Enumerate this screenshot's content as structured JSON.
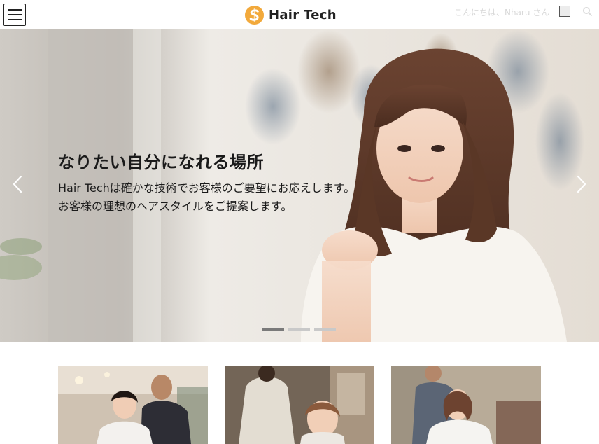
{
  "header": {
    "menu_icon": "hamburger-menu-icon",
    "logo_icon": "hair-tech-logo-mark",
    "brand": "Hair Tech",
    "greeting": "こんにちは、Nharu さん",
    "search_icon": "search-icon"
  },
  "hero": {
    "title": "なりたい自分になれる場所",
    "subtitle_line1": "Hair Techは確かな技術でお客様のご要望にお応えします。",
    "subtitle_line2": "お客様の理想のヘアスタイルをご提案します。",
    "prev_icon": "chevron-left-icon",
    "next_icon": "chevron-right-icon",
    "slide_count": 3,
    "active_slide": 1
  },
  "cards": [
    {
      "image": "salon-stylist-with-customer-photo"
    },
    {
      "image": "stylist-combing-customer-hair-photo"
    },
    {
      "image": "stylist-cutting-hair-photo"
    }
  ],
  "colors": {
    "logo_accent": "#f2a93b",
    "indicator_active": "#7a7a7a",
    "indicator_inactive": "#c9c9c9"
  }
}
